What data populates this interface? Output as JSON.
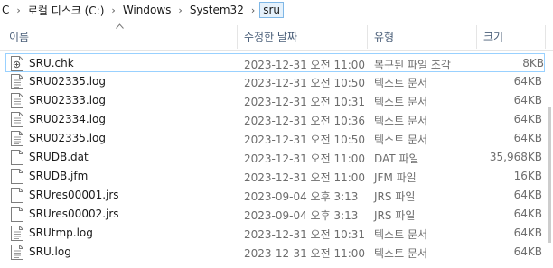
{
  "breadcrumb": {
    "items": [
      "C",
      "로컬 디스크 (C:)",
      "Windows",
      "System32",
      "sru"
    ]
  },
  "columns": {
    "name": "이름",
    "date": "수정한 날짜",
    "type": "유형",
    "size": "크기"
  },
  "files": [
    {
      "name": "SRU.chk",
      "date": "2023-12-31 오전 11:00",
      "type": "복구된 파일 조각",
      "size": "8KB",
      "icon": "chk-file-icon",
      "selected": true
    },
    {
      "name": "SRU02335.log",
      "date": "2023-12-31 오전 10:50",
      "type": "텍스트 문서",
      "size": "64KB",
      "icon": "text-document-icon"
    },
    {
      "name": "SRU02333.log",
      "date": "2023-12-31 오전 10:31",
      "type": "텍스트 문서",
      "size": "64KB",
      "icon": "text-document-icon"
    },
    {
      "name": "SRU02334.log",
      "date": "2023-12-31 오전 10:36",
      "type": "텍스트 문서",
      "size": "64KB",
      "icon": "text-document-icon"
    },
    {
      "name": "SRU02335.log",
      "date": "2023-12-31 오전 10:50",
      "type": "텍스트 문서",
      "size": "64KB",
      "icon": "text-document-icon"
    },
    {
      "name": "SRUDB.dat",
      "date": "2023-12-31 오전 11:00",
      "type": "DAT 파일",
      "size": "35,968KB",
      "icon": "blank-file-icon"
    },
    {
      "name": "SRUDB.jfm",
      "date": "2023-12-31 오전 11:00",
      "type": "JFM 파일",
      "size": "16KB",
      "icon": "blank-file-icon"
    },
    {
      "name": "SRUres00001.jrs",
      "date": "2023-09-04 오후 3:13",
      "type": "JRS 파일",
      "size": "64KB",
      "icon": "blank-file-icon"
    },
    {
      "name": "SRUres00002.jrs",
      "date": "2023-09-04 오후 3:13",
      "type": "JRS 파일",
      "size": "64KB",
      "icon": "blank-file-icon"
    },
    {
      "name": "SRUtmp.log",
      "date": "2023-12-31 오전 10:31",
      "type": "텍스트 문서",
      "size": "64KB",
      "icon": "text-document-icon"
    },
    {
      "name": "SRU.log",
      "date": "2023-12-31 오전 11:00",
      "type": "텍스트 문서",
      "size": "64KB",
      "icon": "text-document-icon"
    }
  ],
  "colors": {
    "header_text": "#4c607a",
    "selection_border": "#99d1ff",
    "breadcrumb_highlight": "#e5f1fb"
  }
}
